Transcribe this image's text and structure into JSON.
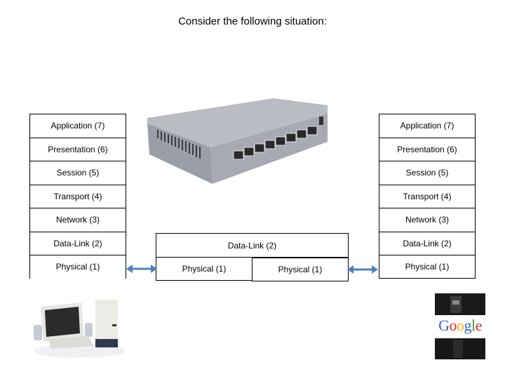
{
  "title": "Consider the following situation:",
  "left_stack": {
    "layers": [
      "Application (7)",
      "Presentation (6)",
      "Session (5)",
      "Transport (4)",
      "Network (3)",
      "Data-Link (2)",
      "Physical (1)"
    ]
  },
  "right_stack": {
    "layers": [
      "Application (7)",
      "Presentation (6)",
      "Session (5)",
      "Transport (4)",
      "Network (3)",
      "Data-Link (2)",
      "Physical (1)"
    ]
  },
  "switch_stack": {
    "datalink": "Data-Link (2)",
    "physical_a": "Physical (1)",
    "physical_b": "Physical (1)"
  },
  "devices": {
    "left": "desktop-computer",
    "middle": "ethernet-switch",
    "right": "google-server"
  },
  "google_logo": [
    "G",
    "o",
    "o",
    "g",
    "l",
    "e"
  ],
  "colors": {
    "arrow": "#4f81bd",
    "google": [
      "#3366cc",
      "#d9282e",
      "#f5b400",
      "#3366cc",
      "#3a9a3a",
      "#d9282e"
    ]
  }
}
